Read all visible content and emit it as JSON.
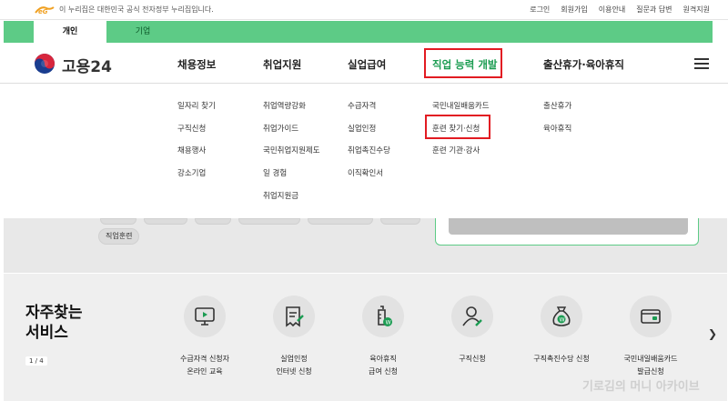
{
  "gov_bar": {
    "notice": "이 누리집은 대한민국 공식 전자정부 누리집입니다.",
    "links": [
      "로그인",
      "회원가입",
      "이용안내",
      "질문과 답변",
      "원격지원"
    ]
  },
  "tabs": {
    "personal": "개인",
    "business": "기업"
  },
  "header": {
    "logo_text": "고용24",
    "nav": [
      "채용정보",
      "취업지원",
      "실업급여",
      "직업 능력 개발",
      "출산휴가·육아휴직"
    ]
  },
  "mega_menu": {
    "col1": [
      "일자리 찾기",
      "구직신청",
      "채용행사",
      "강소기업"
    ],
    "col2": [
      "취업역량강화",
      "취업가이드",
      "국민취업지원제도",
      "일 경험",
      "취업지원금"
    ],
    "col3": [
      "수급자격",
      "실업인정",
      "취업촉진수당",
      "이직확인서"
    ],
    "col4": [
      "국민내일배움카드",
      "훈련 찾기·신청",
      "훈련 기관·강사"
    ],
    "col5": [
      "출산휴가",
      "육아휴직"
    ]
  },
  "chip": "직업훈련",
  "freq": {
    "title_line1": "자주찾는",
    "title_line2": "서비스",
    "pager": "1 / 4",
    "services": [
      {
        "line1": "수급자격 신청자",
        "line2": "온라인 교육",
        "icon": "monitor-play-icon"
      },
      {
        "line1": "실업인정",
        "line2": "인터넷 신청",
        "icon": "document-pen-icon"
      },
      {
        "line1": "육아휴직",
        "line2": "급여 신청",
        "icon": "baby-bottle-icon"
      },
      {
        "line1": "구직신청",
        "line2": "",
        "icon": "person-pen-icon"
      },
      {
        "line1": "구직촉진수당 신청",
        "line2": "",
        "icon": "money-bag-icon"
      },
      {
        "line1": "국민내일배움카드",
        "line2": "발급신청",
        "icon": "card-icon"
      }
    ]
  },
  "watermark": "기로김의 머니 아카이브",
  "colors": {
    "brand_green": "#5dcb86",
    "highlight_red": "#e21b22",
    "accent_text": "#1b9c52"
  }
}
